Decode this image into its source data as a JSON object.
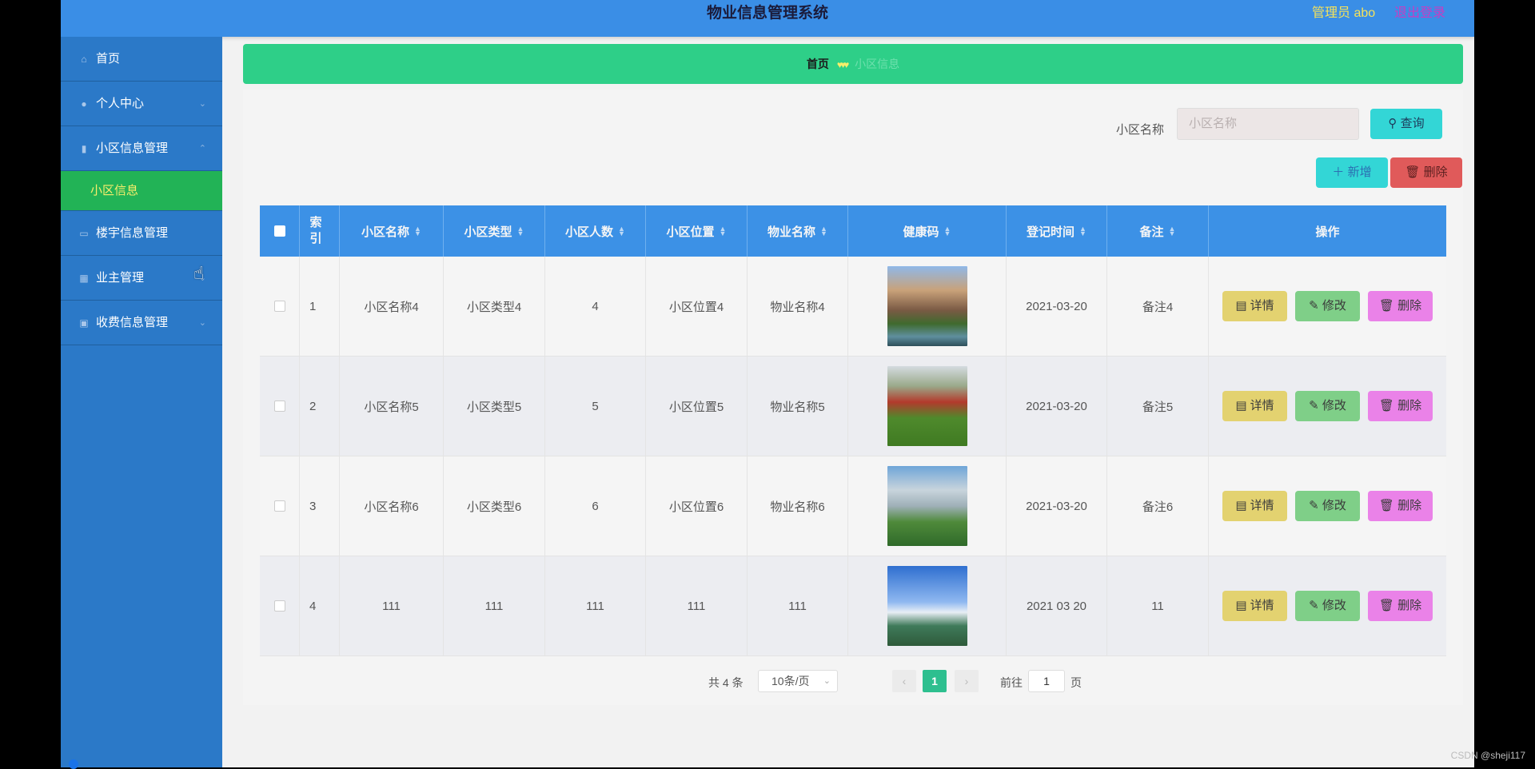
{
  "header": {
    "title": "物业信息管理系统",
    "admin": "管理员 abo",
    "logout": "退出登录"
  },
  "sidebar": {
    "items": [
      {
        "label": "首页",
        "icon": "home-icon"
      },
      {
        "label": "个人中心",
        "icon": "user-icon"
      },
      {
        "label": "小区信息管理",
        "icon": "mic-icon"
      },
      {
        "label": "小区信息",
        "icon": ""
      },
      {
        "label": "楼宇信息管理",
        "icon": "message-icon"
      },
      {
        "label": "业主管理",
        "icon": "grid-icon"
      },
      {
        "label": "收费信息管理",
        "icon": "trash-icon"
      }
    ]
  },
  "breadcrumb": {
    "home": "首页",
    "current": "小区信息"
  },
  "search": {
    "label": "小区名称",
    "placeholder": "小区名称",
    "query_label": "查询"
  },
  "toolbar": {
    "add_label": "新增",
    "delete_label": "删除"
  },
  "table": {
    "headers": [
      "索引",
      "小区名称",
      "小区类型",
      "小区人数",
      "小区位置",
      "物业名称",
      "健康码",
      "登记时间",
      "备注",
      "操作"
    ],
    "rows": [
      {
        "index": "1",
        "name": "小区名称4",
        "type": "小区类型4",
        "count": "4",
        "location": "小区位置4",
        "property": "物业名称4",
        "time": "2021-03-20",
        "note": "备注4"
      },
      {
        "index": "2",
        "name": "小区名称5",
        "type": "小区类型5",
        "count": "5",
        "location": "小区位置5",
        "property": "物业名称5",
        "time": "2021-03-20",
        "note": "备注5"
      },
      {
        "index": "3",
        "name": "小区名称6",
        "type": "小区类型6",
        "count": "6",
        "location": "小区位置6",
        "property": "物业名称6",
        "time": "2021-03-20",
        "note": "备注6"
      },
      {
        "index": "4",
        "name": "111",
        "type": "111",
        "count": "111",
        "location": "111",
        "property": "111",
        "time": "2021 03 20",
        "note": "11"
      }
    ],
    "actions": {
      "detail": "详情",
      "edit": "修改",
      "delete": "删除"
    }
  },
  "pagination": {
    "total": "共 4 条",
    "page_size": "10条/页",
    "current_page": "1",
    "goto_label": "前往",
    "goto_value": "1",
    "page_suffix": "页"
  },
  "watermark": "CSDN @sheji117",
  "colors": {
    "header": "#3a8ee6",
    "sidebar": "#2b79c8",
    "active_submenu": "#22b356",
    "breadcrumb": "#2ecf88",
    "table_header": "#3c91e6"
  }
}
